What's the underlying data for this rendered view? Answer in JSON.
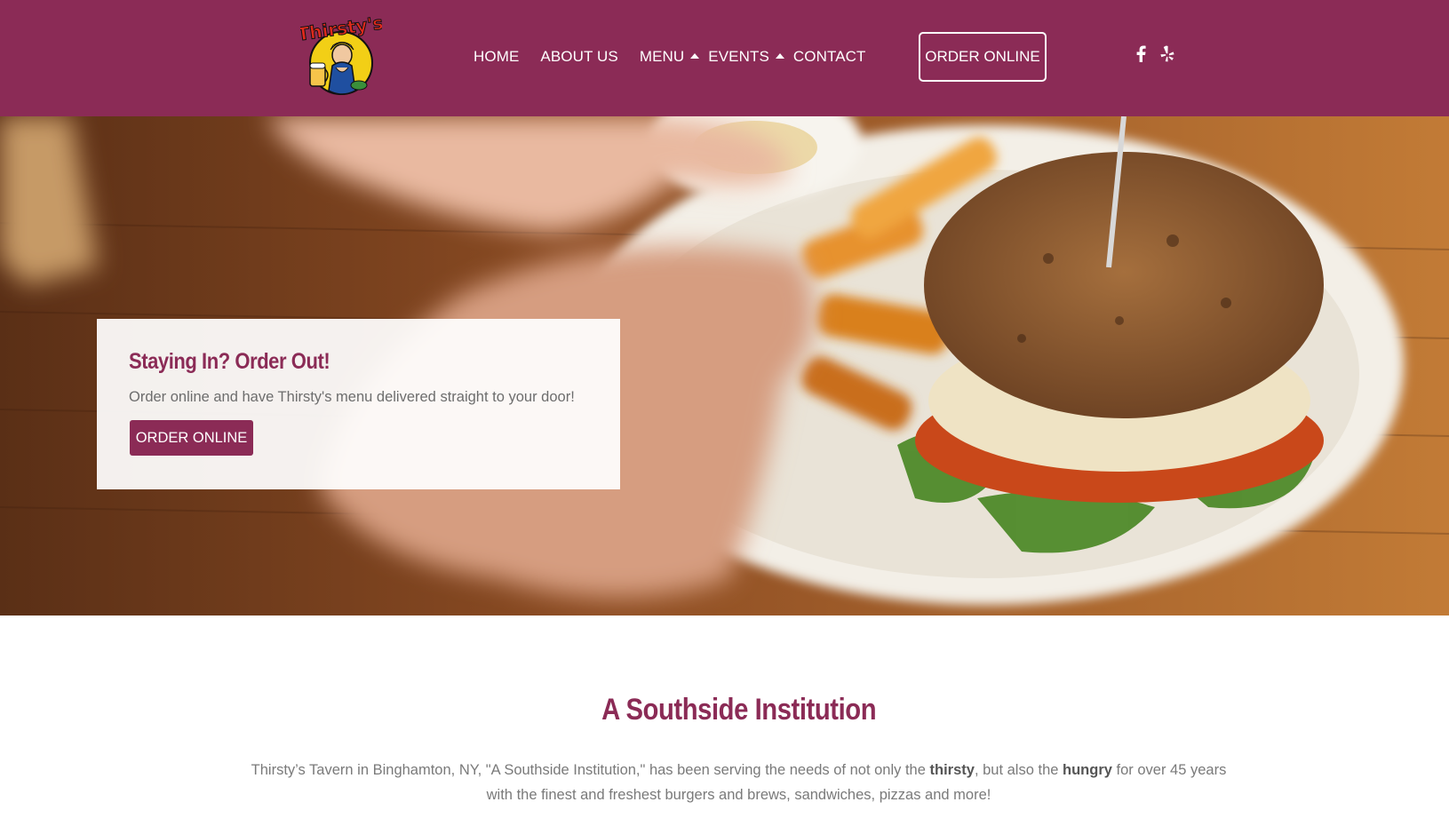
{
  "header": {
    "brand": "Thirsty's",
    "nav": [
      {
        "label": "HOME"
      },
      {
        "label": "ABOUT US"
      },
      {
        "label": "MENU"
      },
      {
        "label": "EVENTS"
      },
      {
        "label": "CONTACT"
      }
    ],
    "order_button": "ORDER ONLINE",
    "social": [
      {
        "icon": "facebook-icon"
      },
      {
        "icon": "yelp-icon"
      }
    ],
    "colors": {
      "brand": "#8b2b56",
      "white": "#ffffff"
    }
  },
  "hero": {
    "promo": {
      "title": "Staying In? Order Out!",
      "text": "Order online and have Thirsty's menu delivered straight to your door!",
      "button": "ORDER ONLINE"
    }
  },
  "intro": {
    "title": "A Southside Institution",
    "text_parts": [
      "Thirsty’s Tavern in Binghamton, NY, \"A Southside Institution,\" has been serving the needs of not only the ",
      "thirsty",
      ", but also the ",
      "hungry",
      " for over 45 years with the finest and freshest burgers and brews, sandwiches, pizzas and more!"
    ]
  }
}
